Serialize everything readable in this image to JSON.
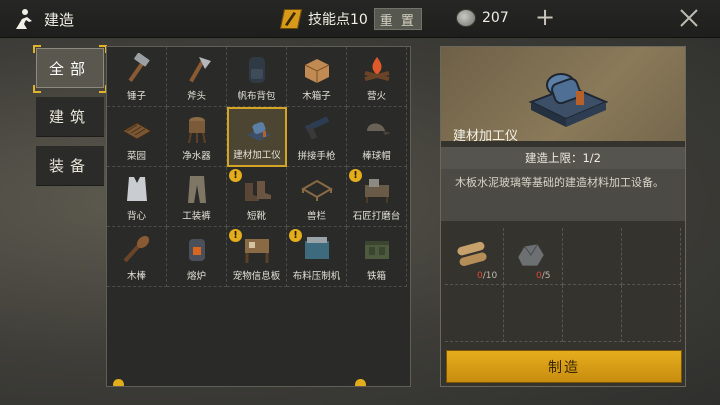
{
  "header": {
    "title": "建造",
    "skill_points_label": "技能点10",
    "reset_label": "重 置",
    "currency_value": "207",
    "plus_label": "+",
    "close_label": "×"
  },
  "tabs": [
    {
      "label": "全部",
      "active": true
    },
    {
      "label": "建筑",
      "active": false
    },
    {
      "label": "装备",
      "active": false
    }
  ],
  "items": [
    {
      "label": "锤子",
      "icon": "hammer-icon",
      "warn": false,
      "selected": false
    },
    {
      "label": "斧头",
      "icon": "axe-icon",
      "warn": false,
      "selected": false
    },
    {
      "label": "帆布背包",
      "icon": "backpack-icon",
      "warn": false,
      "selected": false
    },
    {
      "label": "木箱子",
      "icon": "wooden-box-icon",
      "warn": false,
      "selected": false
    },
    {
      "label": "营火",
      "icon": "campfire-icon",
      "warn": false,
      "selected": false
    },
    {
      "label": "菜园",
      "icon": "garden-icon",
      "warn": false,
      "selected": false
    },
    {
      "label": "净水器",
      "icon": "water-purifier-icon",
      "warn": false,
      "selected": false
    },
    {
      "label": "建材加工仪",
      "icon": "material-processor-icon",
      "warn": false,
      "selected": true
    },
    {
      "label": "拼接手枪",
      "icon": "pistol-icon",
      "warn": false,
      "selected": false
    },
    {
      "label": "棒球帽",
      "icon": "baseball-cap-icon",
      "warn": false,
      "selected": false
    },
    {
      "label": "背心",
      "icon": "vest-icon",
      "warn": false,
      "selected": false
    },
    {
      "label": "工装裤",
      "icon": "pants-icon",
      "warn": false,
      "selected": false
    },
    {
      "label": "短靴",
      "icon": "boots-icon",
      "warn": true,
      "selected": false
    },
    {
      "label": "兽栏",
      "icon": "animal-pen-icon",
      "warn": false,
      "selected": false
    },
    {
      "label": "石匠打磨台",
      "icon": "mason-table-icon",
      "warn": true,
      "selected": false
    },
    {
      "label": "木棒",
      "icon": "club-icon",
      "warn": false,
      "selected": false
    },
    {
      "label": "熔炉",
      "icon": "furnace-icon",
      "warn": false,
      "selected": false
    },
    {
      "label": "宠物信息板",
      "icon": "pet-board-icon",
      "warn": true,
      "selected": false
    },
    {
      "label": "布料压制机",
      "icon": "cloth-press-icon",
      "warn": true,
      "selected": false
    },
    {
      "label": "铁箱",
      "icon": "iron-box-icon",
      "warn": false,
      "selected": false
    }
  ],
  "detail": {
    "name": "建材加工仪",
    "limit_label": "建造上限：1/2",
    "description": "木板水泥玻璃等基础的建造材料加工设备。",
    "materials": [
      {
        "icon": "wood-logs-icon",
        "have": "0",
        "need": "/10"
      },
      {
        "icon": "ore-icon",
        "have": "0",
        "need": "/5"
      }
    ],
    "build_label": "制造"
  },
  "colors": {
    "accent": "#d3a526",
    "build_button": "#e6ad1e",
    "warning": "#e3ad1c",
    "missing": "#d84a3a"
  }
}
